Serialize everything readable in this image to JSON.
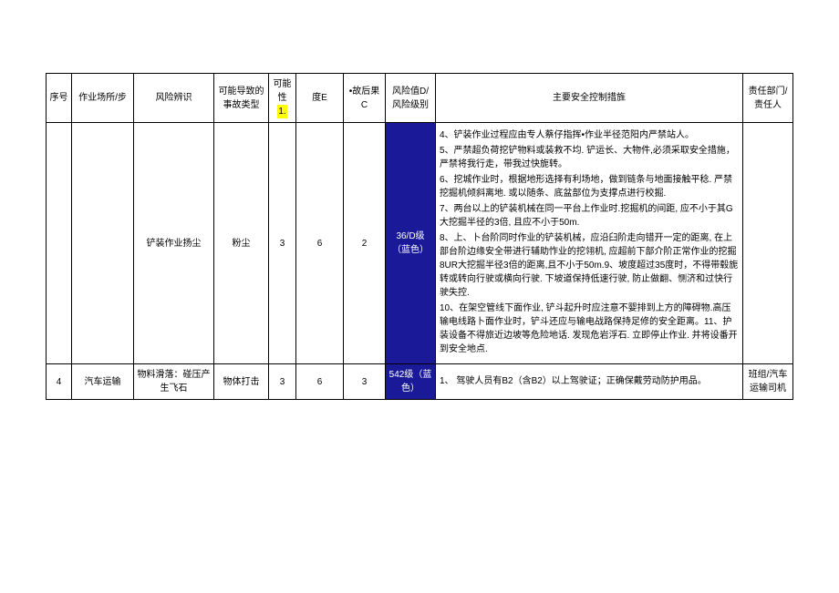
{
  "header": {
    "seq": "序号",
    "place": "作业场所/步",
    "risk": "风险辨识",
    "type": "可能导致的事故类型",
    "L_line1": "可能性",
    "L_line2": "1.",
    "E": "度E",
    "C": "•故后果C",
    "D": "风险值D/风险级别",
    "measures": "主要安全控制措旌",
    "resp": "责任部门/责任人"
  },
  "rows": [
    {
      "seq": "",
      "place": "",
      "risk": "铲装作业扬尘",
      "type": "粉尘",
      "L": "3",
      "E": "6",
      "C": "2",
      "D": "36/D级（蓝色）",
      "resp": "",
      "measures": [
        "4、铲装作业过程应由专人蔡仔指挥•作业半径范阳内严禁站人。",
        "5、严禁超负荷挖铲物料或装救不均. 铲运长、大物件,必须采取安全措施，严禁将我行走，带我过快旎转。",
        "6、挖城作业时，根据地形选择有利场地，做到链条与地面接触平稔.  严禁挖掘机倾斜离地. 或以随条、底盆部位为支撑点进行校掘.",
        "7、两台以上的铲装机械在同一平台上作业时.挖掘机的间距, 应不小于其G大挖掘半径的3倍, 且应不小于50m.",
        "8、上、卜台阶同时作业的铲装机械，应沿臼阶走向错开一定的距离,  在上部台阶边缘安全带进行辅助怍业的挖翎机, 应超前下部介阶正常作业的挖掘8UR大挖掘半径3倍的距离,且不小于50m.9、坡度超过35度时，不得带毂旎转或转向行驶或横向行驶. 下坡道保持低速行驶, 防止做翻、恻济和过快行驶失控.",
        "10、在架空管线下面作业, 铲斗起升时应注意不婴排到上方的障碍物.高压输电线路卜面作业时，铲斗还应与输电战路保持足修的安全距离。11、护装设备不得旅近边坡等危险地话. 发现危岩浮石. 立即停止作业. 并将设番开到安全地点."
      ]
    },
    {
      "seq": "4",
      "place": "汽车运输",
      "risk": "物料滑落：碰压产生飞石",
      "type": "物体打击",
      "L": "3",
      "E": "6",
      "C": "3",
      "D": "542级（蓝色）",
      "resp": "班组/汽车运输司机",
      "measures": [
        "1、 驾驶人员有B2（含B2）以上驾驶证；正确保戴劳动防护用品。"
      ]
    }
  ]
}
